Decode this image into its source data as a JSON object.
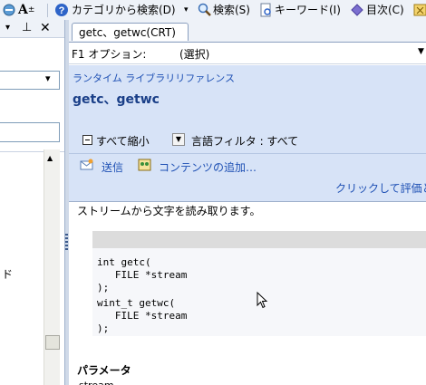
{
  "toolbar": {
    "font_size_label": "A",
    "category_search_label": "カテゴリから検索(D)",
    "search_label": "検索(S)",
    "keyword_label": "キーワード(I)",
    "toc_label": "目次(C)"
  },
  "left_pane": {
    "close_glyph": "✕",
    "pin_glyph": "⊥",
    "dropdown_arrow": "▾",
    "partial_char": "ド"
  },
  "tab": {
    "label": "getc、getwc(CRT)"
  },
  "f1_options": {
    "label": "F1 オプション:",
    "value": "(選択)"
  },
  "header": {
    "breadcrumb": "ランタイム ライブラリリファレンス",
    "title": "getc、getwc",
    "collapse_all": "すべて縮小",
    "language_filter": "言語フィルタ : すべて",
    "send_label": "送信",
    "add_content_label": "コンテンツの追加…",
    "rate_link": "クリックして評価とフ"
  },
  "body": {
    "description": "ストリームから文字を読み取ります。",
    "code_lines": [
      "int getc(",
      "   FILE *stream",
      ");",
      "wint_t getwc(",
      "   FILE *stream",
      ");"
    ],
    "params_heading": "パラメータ",
    "params_partial": "stream"
  },
  "colors": {
    "header_band": "#d7e3f7",
    "link": "#1e50b4",
    "toolbar_bg": "#eef2f8"
  }
}
